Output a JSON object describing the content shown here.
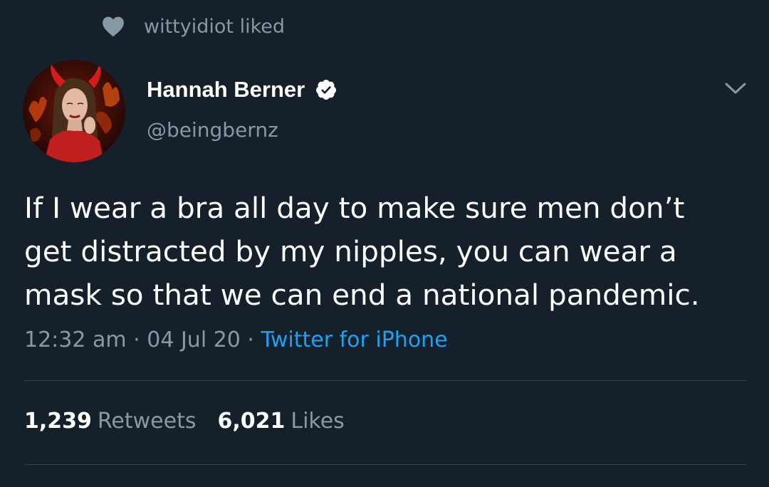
{
  "social_context": {
    "icon": "heart-icon",
    "text": "wittyidiot liked"
  },
  "author": {
    "display_name": "Hannah Berner",
    "handle": "@beingbernz",
    "verified": true,
    "verified_icon": "verified-badge-icon"
  },
  "tweet": {
    "text_lines": [
      "If I wear a bra all day to make sure men don’t",
      "get distracted by my nipples, you can wear a",
      "mask so that we can end a national pandemic."
    ],
    "time": "12:32 am",
    "date": "04 Jul 20",
    "separator": "·",
    "source": "Twitter for iPhone"
  },
  "stats": {
    "retweets_count": "1,239",
    "retweets_label": "Retweets",
    "likes_count": "6,021",
    "likes_label": "Likes"
  },
  "colors": {
    "background": "#15202b",
    "primary_text": "#ffffff",
    "secondary_text": "#8899a6",
    "link": "#1da1f2",
    "divider": "#38444d"
  }
}
